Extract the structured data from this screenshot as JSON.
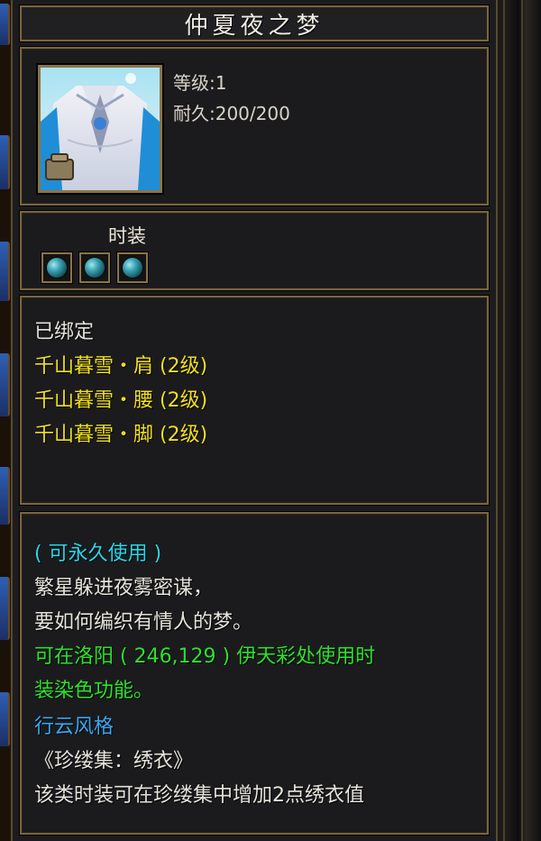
{
  "item": {
    "name": "仲夏夜之梦",
    "level_label": "等级:1",
    "durability_label": "耐久:200/200",
    "portrait_icon": "fashion-costume-portrait-icon",
    "category": "时装",
    "gem_slots": [
      {
        "icon": "teal-gem-icon"
      },
      {
        "icon": "teal-gem-icon"
      },
      {
        "icon": "teal-gem-icon"
      }
    ]
  },
  "set_info": {
    "bound": "已绑定",
    "pieces": [
      "千山暮雪・肩 (2级)",
      "千山暮雪・腰 (2级)",
      "千山暮雪・脚 (2级)"
    ]
  },
  "description": {
    "permanent": "( 可永久使用 )",
    "poem_line1": "繁星躲进夜雾密谋，",
    "poem_line2": "要如何编织有情人的梦。",
    "dye_line1": "可在洛阳 ( 246,129 ) 伊天彩处使用时",
    "dye_line2": "装染色功能。",
    "style": "行云风格",
    "collection": "《珍缕集：绣衣》",
    "collection_note": "该类时装可在珍缕集中增加2点绣衣值"
  },
  "colors": {
    "white_text": "#e6e4dc",
    "yellow_text": "#f0e020",
    "cyan_text": "#2ad6e6",
    "green_text": "#2ee02e",
    "blue_text": "#3aa6f0",
    "border_gold": "#7a6540"
  }
}
